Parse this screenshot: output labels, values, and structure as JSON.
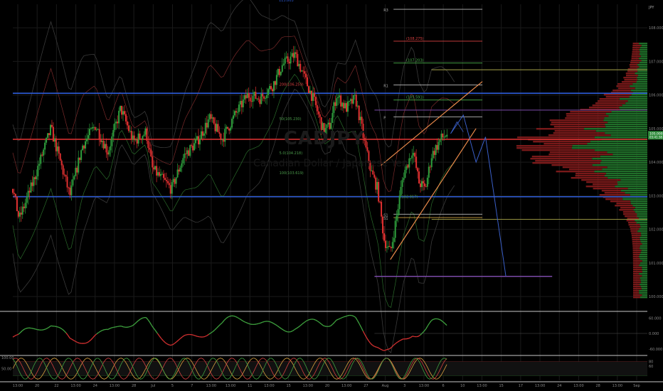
{
  "symbol": {
    "ticker": "CADJPY",
    "name": "Canadian Dollar / Japanese Yen",
    "currency": "JPY",
    "top_label": "113.803"
  },
  "colors": {
    "bull": "#2e9e3c",
    "bear": "#e03030",
    "blue": "#2d5bd6",
    "red": "#d63030",
    "orange": "#e8894a",
    "purple": "#7b4aa8",
    "olive": "#a8a44a",
    "grid": "#1a1a1a",
    "pane_sep": "#c8c8c8"
  },
  "chart_data": [
    {
      "type": "candlestick",
      "pane": "price",
      "y_axis": {
        "min": 99.6,
        "max": 108.7,
        "ticks": [
          "108.000",
          "107.000",
          "106.000",
          "105.000",
          "104.000",
          "103.000",
          "102.000",
          "101.000",
          "100.000"
        ],
        "tick_values": [
          108,
          107,
          106,
          105,
          104,
          103,
          102,
          101,
          100
        ]
      },
      "x_axis": {
        "tick_labels": [
          "13:00",
          "20",
          "22",
          "13:00",
          "24",
          "13:00",
          "28",
          "Jul",
          "5",
          "7",
          "13:00",
          "13:00",
          "11",
          "13:00",
          "15",
          "13:00",
          "20",
          "13:00",
          "27",
          "Aug",
          "3",
          "13:00",
          "6",
          "10",
          "13:00",
          "15",
          "17",
          "13:00",
          "24",
          "13:00",
          "28",
          "13:00",
          "Sep"
        ]
      },
      "current_price": {
        "label": "105.000",
        "sublabel": "03:41:38",
        "value": 104.8
      },
      "horizontal_levels": [
        {
          "value": 106.05,
          "color": "blue"
        },
        {
          "value": 104.68,
          "color": "red"
        },
        {
          "value": 102.97,
          "color": "blue"
        }
      ],
      "pivot_levels": [
        {
          "label": "R3",
          "value": 108.55,
          "price": ""
        },
        {
          "label": "",
          "value": 107.6,
          "price": "(108.275)"
        },
        {
          "label": "",
          "value": 106.95,
          "price": "(107.203)"
        },
        {
          "label": "R1",
          "value": 106.3,
          "price": ""
        },
        {
          "label": "",
          "value": 105.85,
          "price": "(105.591)"
        },
        {
          "label": "P",
          "value": 105.35,
          "price": ""
        },
        {
          "label": "S1",
          "value": 102.45,
          "price": ""
        },
        {
          "label": "S1",
          "value": 102.35,
          "price": ""
        }
      ],
      "ma_labels": [
        "200(106.259)",
        "50(105.230)",
        "5.0(104.218)",
        "100(103.619)",
        "(102.917)"
      ],
      "path_projection": [
        {
          "t": 0.69,
          "v": 104.85
        },
        {
          "t": 0.71,
          "v": 105.4
        },
        {
          "t": 0.73,
          "v": 104.0
        },
        {
          "t": 0.745,
          "v": 104.75
        },
        {
          "t": 0.777,
          "v": 100.6
        }
      ],
      "target_level": {
        "value": 100.6
      },
      "volume_profile": true
    },
    {
      "type": "line",
      "pane": "rsi",
      "y_axis": {
        "ticks": [
          "60.000",
          "0.000",
          "-60.000"
        ],
        "tick_values": [
          60,
          0,
          -60
        ]
      }
    },
    {
      "type": "line",
      "pane": "stochastic",
      "y_axis": {
        "ticks": [
          "100.00",
          "50.00",
          "80",
          "60"
        ],
        "tick_values": [
          100,
          50,
          80,
          60
        ]
      }
    }
  ]
}
